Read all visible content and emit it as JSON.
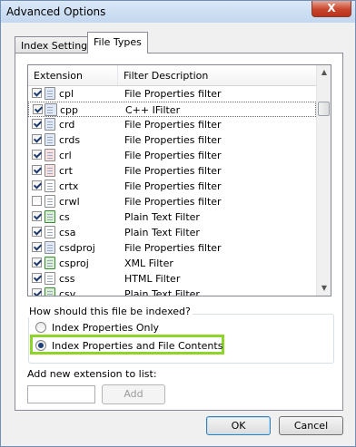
{
  "window": {
    "title": "Advanced Options",
    "close_label": "X"
  },
  "tabs": [
    {
      "label": "Index Settings"
    },
    {
      "label": "File Types"
    }
  ],
  "list": {
    "columns": [
      "Extension",
      "Filter Description"
    ],
    "rows": [
      {
        "ext": "cpl",
        "desc": "File Properties filter",
        "checked": true,
        "icon": "control-panel-file-icon"
      },
      {
        "ext": "cpp",
        "desc": "C++ IFilter",
        "checked": true,
        "icon": "cpp-file-icon",
        "selected": true
      },
      {
        "ext": "crd",
        "desc": "File Properties filter",
        "checked": true,
        "icon": "card-file-icon"
      },
      {
        "ext": "crds",
        "desc": "File Properties filter",
        "checked": true,
        "icon": "cards-file-icon"
      },
      {
        "ext": "crl",
        "desc": "File Properties filter",
        "checked": true,
        "icon": "certificate-list-icon"
      },
      {
        "ext": "crt",
        "desc": "File Properties filter",
        "checked": true,
        "icon": "certificate-icon"
      },
      {
        "ext": "crtx",
        "desc": "File Properties filter",
        "checked": true,
        "icon": "chart-template-icon"
      },
      {
        "ext": "crwl",
        "desc": "File Properties filter",
        "checked": false,
        "icon": "blank-file-icon"
      },
      {
        "ext": "cs",
        "desc": "Plain Text Filter",
        "checked": true,
        "icon": "csharp-file-icon"
      },
      {
        "ext": "csa",
        "desc": "Plain Text Filter",
        "checked": true,
        "icon": "blank-file-icon"
      },
      {
        "ext": "csdproj",
        "desc": "File Properties filter",
        "checked": true,
        "icon": "project-file-icon"
      },
      {
        "ext": "csproj",
        "desc": "XML Filter",
        "checked": true,
        "icon": "csharp-project-icon"
      },
      {
        "ext": "css",
        "desc": "HTML Filter",
        "checked": true,
        "icon": "stylesheet-file-icon"
      },
      {
        "ext": "csv",
        "desc": "Plain Text Filter",
        "checked": true,
        "icon": "excel-csv-icon"
      }
    ]
  },
  "index_options": {
    "question": "How should this file be indexed?",
    "option_properties_only": "Index Properties Only",
    "option_properties_and_contents": "Index Properties and File Contents",
    "selected": "option_properties_and_contents"
  },
  "add_extension": {
    "label": "Add new extension to list:",
    "value": "",
    "button_label": "Add"
  },
  "buttons": {
    "ok": "OK",
    "cancel": "Cancel"
  },
  "colors": {
    "highlight": "#8ed52a",
    "title_bar": "#c3d7ef"
  }
}
